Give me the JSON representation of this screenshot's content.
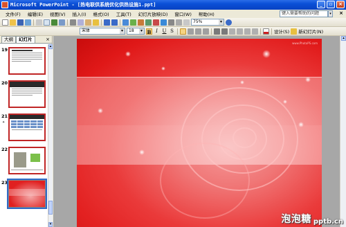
{
  "window": {
    "title": "Microsoft PowerPoint - [热电联供系统优化供热设施1.ppt]",
    "btn_minimize": "_",
    "btn_restore": "▫",
    "btn_close": "×"
  },
  "menubar": {
    "items": [
      "文件(F)",
      "编辑(E)",
      "视图(V)",
      "插入(I)",
      "格式(O)",
      "工具(T)",
      "幻灯片放映(D)",
      "窗口(W)",
      "帮助(H)"
    ],
    "help_placeholder": "键入需要帮助的问题",
    "close": "×"
  },
  "toolbar_standard": {
    "zoom": "75%"
  },
  "toolbar_formatting": {
    "font": "宋体",
    "font_size": "18",
    "bold": "B",
    "italic": "I",
    "underline": "U",
    "shadow": "S",
    "design_label": "设计(S)",
    "new_slide_label": "新幻灯片(N)"
  },
  "left_pane": {
    "tab_outline": "大纲",
    "tab_slides": "幻灯片",
    "close": "×",
    "slides": [
      {
        "number": "19",
        "style": "text"
      },
      {
        "number": "20",
        "style": "dark-header"
      },
      {
        "number": "21",
        "style": "table"
      },
      {
        "number": "22",
        "style": "image"
      },
      {
        "number": "23",
        "style": "rose",
        "selected": true
      }
    ]
  },
  "slide": {
    "corner_text": "www.PhotoPS.com"
  },
  "watermark": {
    "cn": "泡泡糖",
    "en": "pptb.cn"
  },
  "colors": {
    "titlebar": "#0a4fd6",
    "slide_red": "#e01818",
    "selection": "#316ac5"
  }
}
